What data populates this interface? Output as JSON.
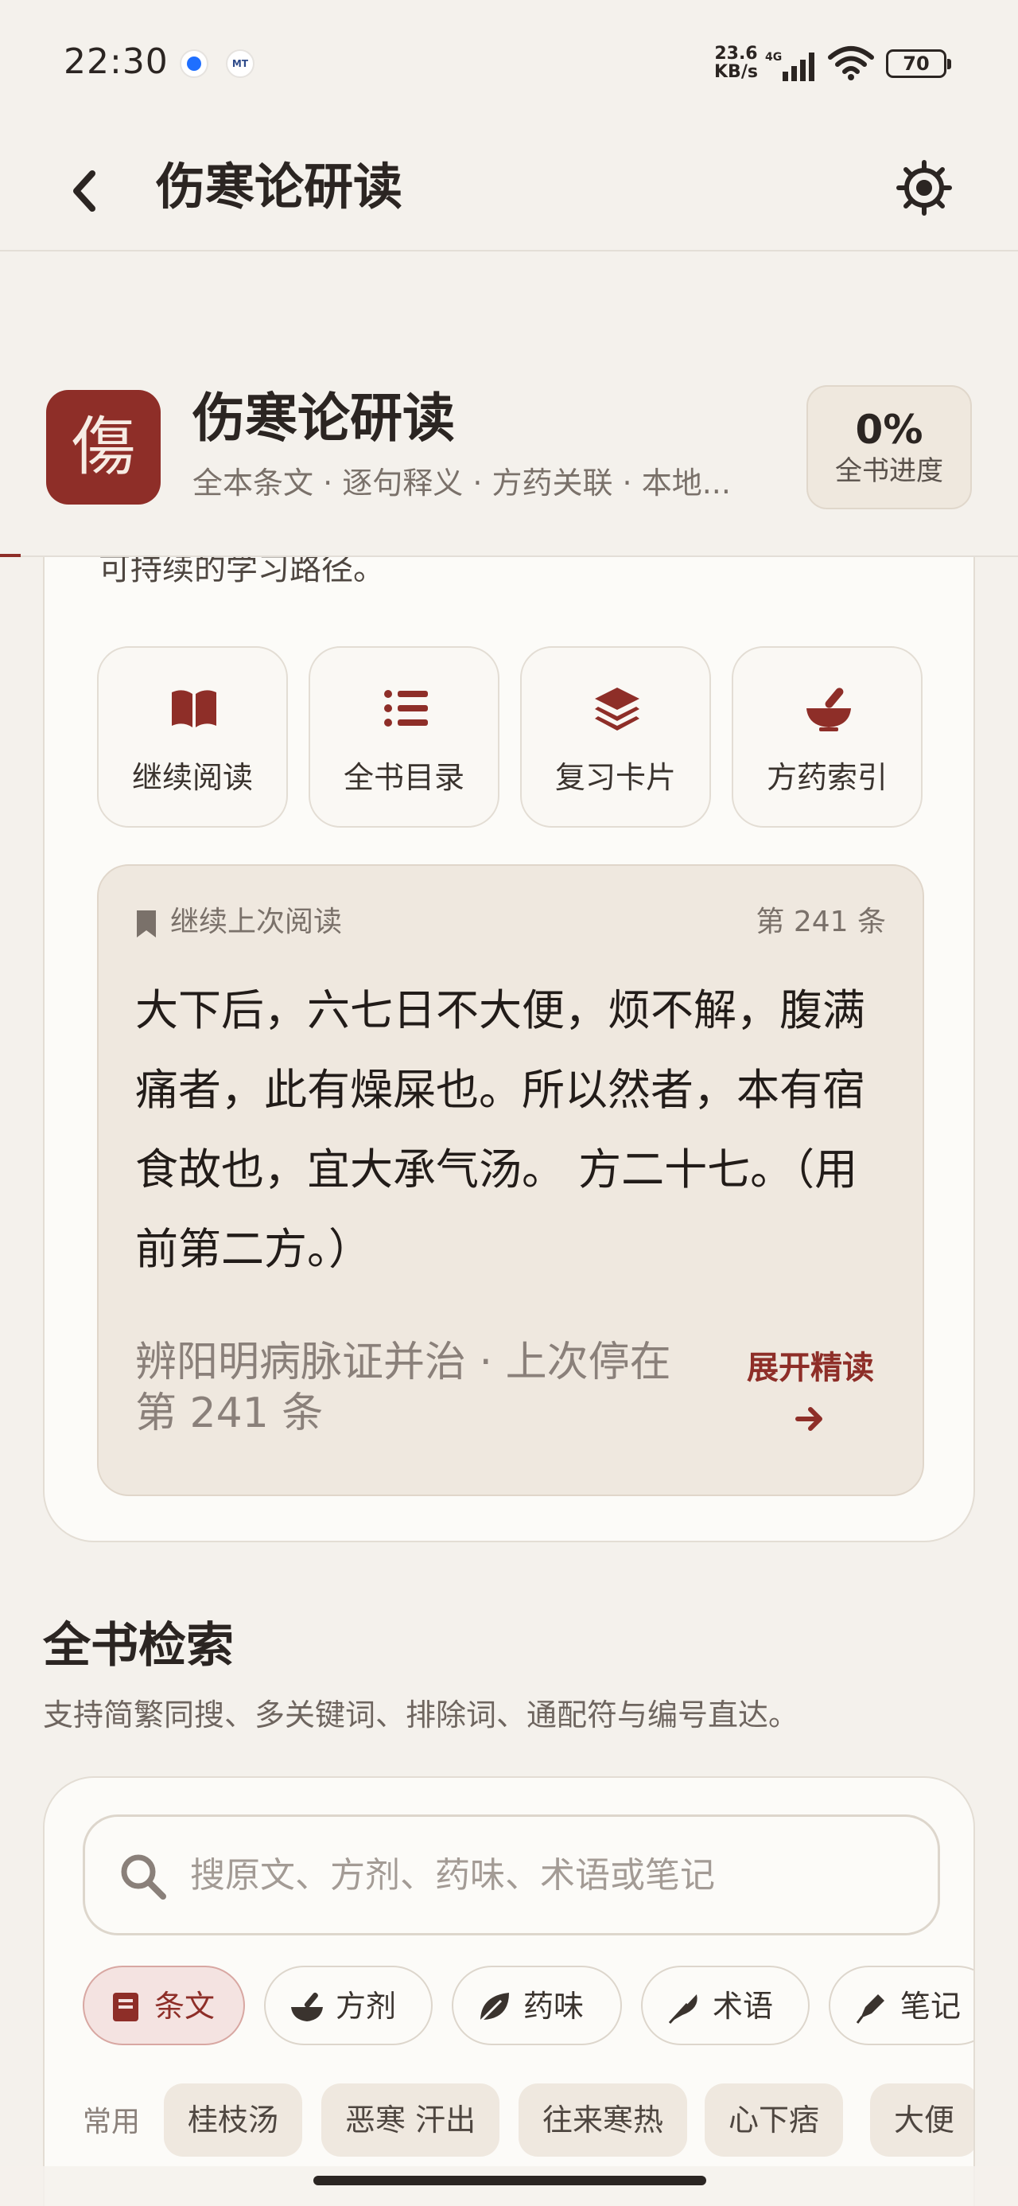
{
  "status_bar": {
    "time": "22:30",
    "mt_badge": "MT",
    "net_speed_value": "23.6",
    "net_speed_unit": "KB/s",
    "network_type": "4G",
    "battery": "70"
  },
  "app_bar": {
    "title": "伤寒论研读",
    "back_icon": "chevron-left-icon",
    "settings_icon": "gear-icon"
  },
  "book_header": {
    "logo_char": "傷",
    "title": "伤寒论研读",
    "subtitle": "全本条文 · 逐句释义 · 方药关联 · 本地...",
    "progress_value": "0%",
    "progress_label": "全书进度"
  },
  "main_card": {
    "intro_partial": "可持续的学习路径。",
    "actions": [
      {
        "label": "继续阅读",
        "icon": "book-open-icon"
      },
      {
        "label": "全书目录",
        "icon": "list-icon"
      },
      {
        "label": "复习卡片",
        "icon": "layers-icon"
      },
      {
        "label": "方药索引",
        "icon": "mortar-pestle-icon"
      }
    ],
    "continue": {
      "header": "继续上次阅读",
      "number": "第 241 条",
      "text": "大下后，六七日不大便，烦不解，腹满痛者，此有燥屎也。所以然者，本有宿食故也，宜大承气汤。 方二十七。（用前第二方。）",
      "meta": "辨阳明病脉证并治 · 上次停在第 241 条",
      "expand_label": "展开精读"
    }
  },
  "search_section": {
    "title": "全书检索",
    "description": "支持简繁同搜、多关键词、排除词、通配符与编号直达。",
    "placeholder": "搜原文、方剂、药味、术语或笔记",
    "tabs": [
      {
        "label": "条文",
        "icon": "book-icon",
        "active": true
      },
      {
        "label": "方剂",
        "icon": "mortar-pestle-icon",
        "active": false
      },
      {
        "label": "药味",
        "icon": "leaf-icon",
        "active": false
      },
      {
        "label": "术语",
        "icon": "feather-icon",
        "active": false
      },
      {
        "label": "笔记",
        "icon": "pen-icon",
        "active": false
      }
    ],
    "quick_label": "常用",
    "quick_chips": [
      "桂枝汤",
      "恶寒 汗出",
      "往来寒热",
      "心下痞",
      "大便"
    ]
  },
  "colors": {
    "brand": "#8e2e28",
    "background": "#f4f1ec",
    "card": "#fcfbf8",
    "continue_bg": "#efe8df"
  }
}
